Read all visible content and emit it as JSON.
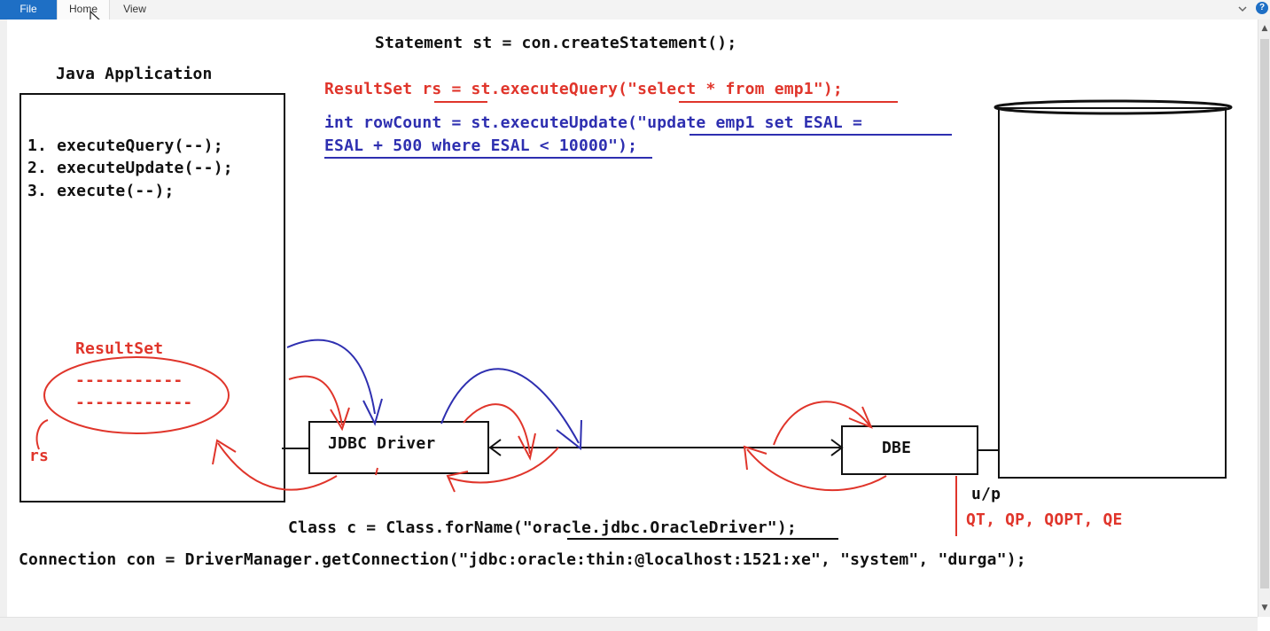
{
  "ribbon": {
    "tabs": [
      "File",
      "Home",
      "View"
    ]
  },
  "colors": {
    "red": "#e0352b",
    "blue": "#2e2fb0",
    "black": "#111111",
    "ribbon_blue": "#1e6fc5"
  },
  "icons": [
    "chevron-down-icon",
    "help-icon",
    "mouse-cursor-icon"
  ],
  "code": {
    "statement": "Statement st = con.createStatement();",
    "resultset_query": "ResultSet rs = st.executeQuery(\"select * from emp1\");",
    "update_line1": "int rowCount = st.executeUpdate(\"update emp1 set ESAL =",
    "update_line2": "ESAL + 500 where ESAL < 10000\");",
    "class_forname": "Class c = Class.forName(\"oracle.jdbc.OracleDriver\");",
    "connection": "Connection con = DriverManager.getConnection(\"jdbc:oracle:thin:@localhost:1521:xe\", \"system\", \"durga\");"
  },
  "diagram": {
    "java_app_title": "Java Application",
    "methods": [
      "1. executeQuery(--);",
      "2. executeUpdate(--);",
      "3. execute(--);"
    ],
    "resultset_label": "ResultSet",
    "resultset_rows": [
      "-----------",
      "------------"
    ],
    "rs_label": "rs",
    "jdbc_driver": "JDBC Driver",
    "dbe": "DBE",
    "up_label": "u/p",
    "query_stages": "QT, QP, QOPT, QE"
  }
}
